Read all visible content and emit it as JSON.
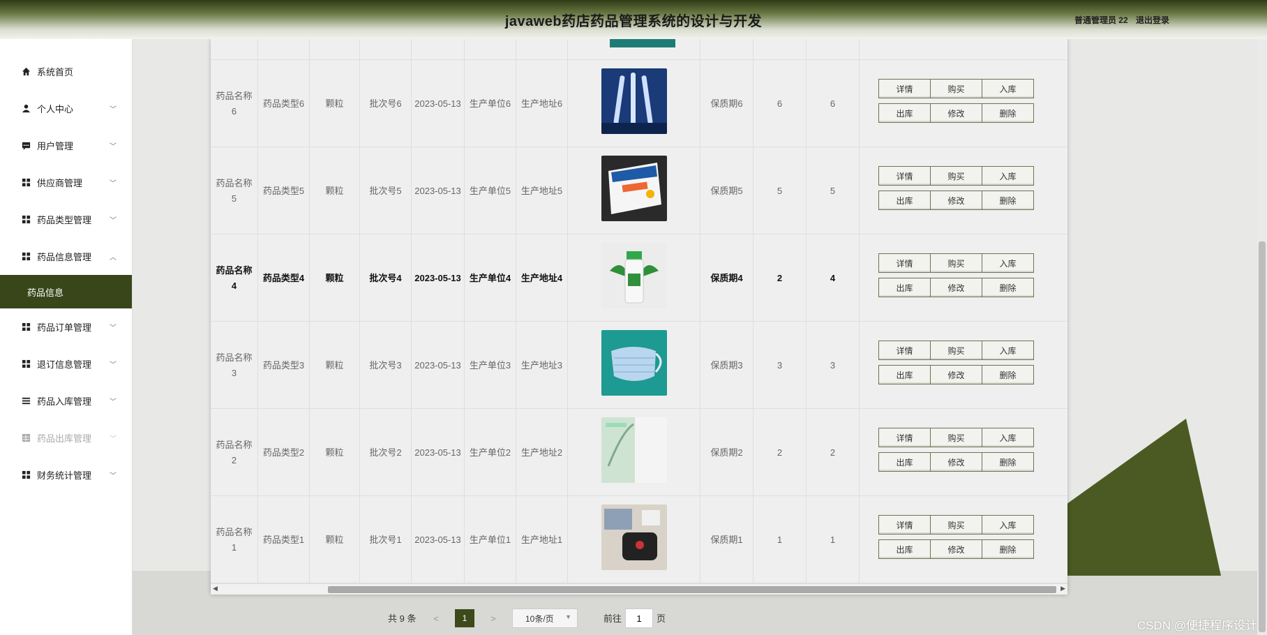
{
  "header": {
    "title": "javaweb药店药品管理系统的设计与开发",
    "user_role": "普通管理员 22",
    "logout": "退出登录"
  },
  "sidebar": {
    "items": [
      {
        "label": "系统首页",
        "icon": "home-icon"
      },
      {
        "label": "个人中心",
        "icon": "user-icon"
      },
      {
        "label": "用户管理",
        "icon": "chat-icon"
      },
      {
        "label": "供应商管理",
        "icon": "grid-icon"
      },
      {
        "label": "药品类型管理",
        "icon": "grid-icon"
      },
      {
        "label": "药品信息管理",
        "icon": "grid-icon"
      },
      {
        "label": "药品订单管理",
        "icon": "grid-icon"
      },
      {
        "label": "退订信息管理",
        "icon": "grid-icon"
      },
      {
        "label": "药品入库管理",
        "icon": "list-icon"
      },
      {
        "label": "药品出库管理",
        "icon": "table-icon"
      },
      {
        "label": "财务统计管理",
        "icon": "grid-icon"
      }
    ],
    "submenu_active": "药品信息"
  },
  "actions": {
    "detail": "详情",
    "buy": "购买",
    "stock_in": "入库",
    "stock_out": "出库",
    "edit": "修改",
    "delete": "删除"
  },
  "rows": [
    {
      "name": "药品名称6",
      "type": "药品类型6",
      "form": "颗粒",
      "batch": "批次号6",
      "date": "2023-05-13",
      "maker": "生产单位6",
      "address": "生产地址6",
      "shelf": "保质期6",
      "n1": "6",
      "n2": "6",
      "img": "vials"
    },
    {
      "name": "药品名称5",
      "type": "药品类型5",
      "form": "颗粒",
      "batch": "批次号5",
      "date": "2023-05-13",
      "maker": "生产单位5",
      "address": "生产地址5",
      "shelf": "保质期5",
      "n1": "5",
      "n2": "5",
      "img": "box"
    },
    {
      "name": "药品名称4",
      "type": "药品类型4",
      "form": "颗粒",
      "batch": "批次号4",
      "date": "2023-05-13",
      "maker": "生产单位4",
      "address": "生产地址4",
      "shelf": "保质期4",
      "n1": "2",
      "n2": "4",
      "img": "bottle"
    },
    {
      "name": "药品名称3",
      "type": "药品类型3",
      "form": "颗粒",
      "batch": "批次号3",
      "date": "2023-05-13",
      "maker": "生产单位3",
      "address": "生产地址3",
      "shelf": "保质期3",
      "n1": "3",
      "n2": "3",
      "img": "mask"
    },
    {
      "name": "药品名称2",
      "type": "药品类型2",
      "form": "颗粒",
      "batch": "批次号2",
      "date": "2023-05-13",
      "maker": "生产单位2",
      "address": "生产地址2",
      "shelf": "保质期2",
      "n1": "2",
      "n2": "2",
      "img": "package"
    },
    {
      "name": "药品名称1",
      "type": "药品类型1",
      "form": "颗粒",
      "batch": "批次号1",
      "date": "2023-05-13",
      "maker": "生产单位1",
      "address": "生产地址1",
      "shelf": "保质期1",
      "n1": "1",
      "n2": "1",
      "img": "device"
    }
  ],
  "pagination": {
    "total": "共 9 条",
    "prev": "<",
    "current_page": "1",
    "next": ">",
    "page_size": "10条/页",
    "goto_label": "前往",
    "goto_value": "1",
    "goto_unit": "页"
  },
  "watermark": "CSDN @便捷程序设计",
  "colors": {
    "accent": "#38461a",
    "header_dark": "#2f3b17",
    "triangle": "#4a5a22"
  }
}
